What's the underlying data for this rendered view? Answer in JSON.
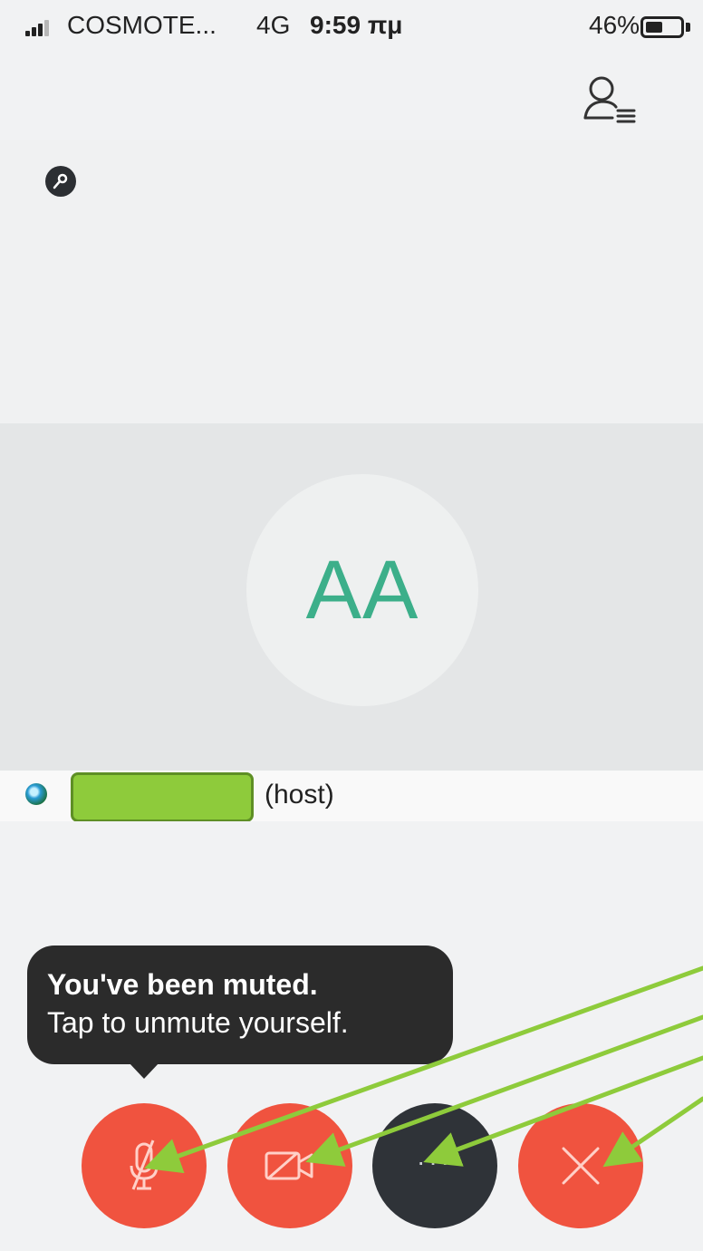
{
  "status_bar": {
    "carrier": "COSMOTE...",
    "network": "4G",
    "time": "9:59 πμ",
    "battery": "46%"
  },
  "participant": {
    "initials": "AA",
    "name_suffix": "(host)"
  },
  "tooltip": {
    "title": "You've been muted.",
    "body": "Tap to unmute yourself."
  },
  "controls": {
    "more_label": "···"
  },
  "colors": {
    "accent_red": "#f0533f",
    "dark_button": "#2f3338",
    "avatar_text": "#3caf8a",
    "annotation_arrow": "#8ecb3b"
  }
}
